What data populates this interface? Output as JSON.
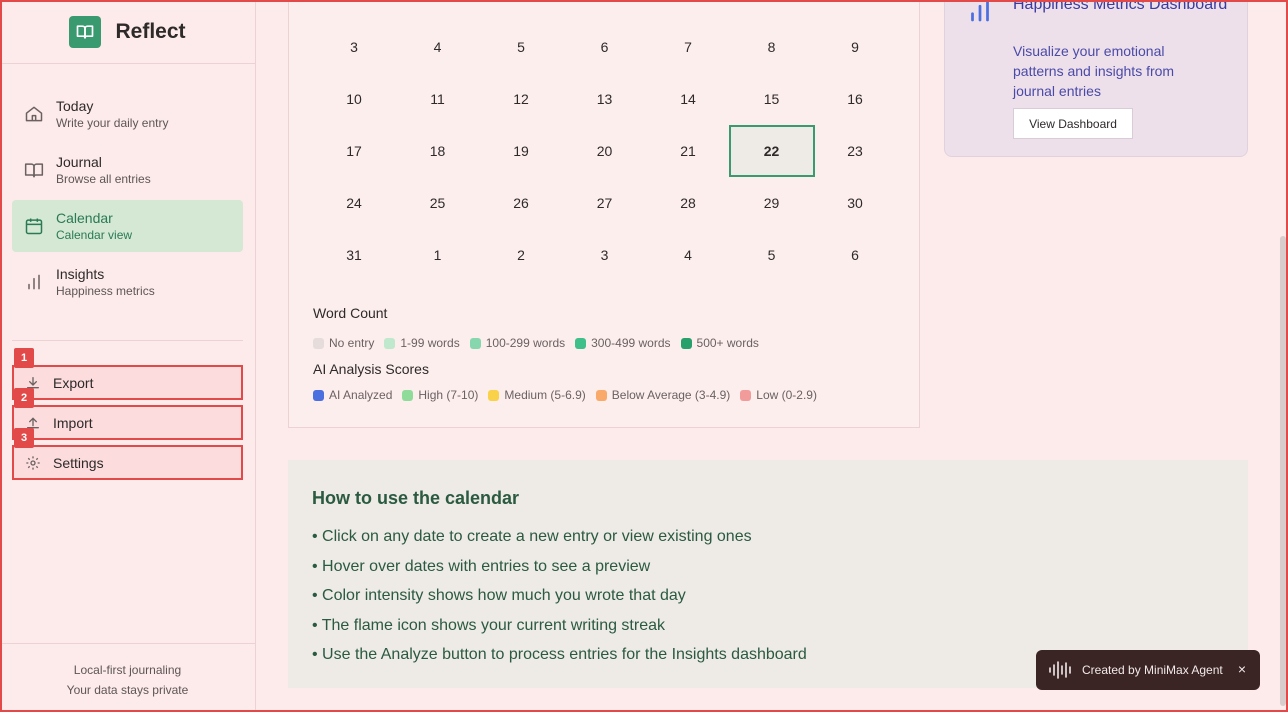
{
  "app": {
    "name": "Reflect"
  },
  "nav": [
    {
      "title": "Today",
      "sub": "Write your daily entry",
      "icon": "home-icon"
    },
    {
      "title": "Journal",
      "sub": "Browse all entries",
      "icon": "book-open-icon"
    },
    {
      "title": "Calendar",
      "sub": "Calendar view",
      "icon": "calendar-icon",
      "active": true
    },
    {
      "title": "Insights",
      "sub": "Happiness metrics",
      "icon": "bar-chart-icon"
    }
  ],
  "utils": [
    {
      "mark": "1",
      "label": "Export",
      "icon": "download-icon"
    },
    {
      "mark": "2",
      "label": "Import",
      "icon": "upload-icon"
    },
    {
      "mark": "3",
      "label": "Settings",
      "icon": "gear-icon"
    }
  ],
  "footer": {
    "line1": "Local-first journaling",
    "line2": "Your data stays private"
  },
  "calendar": {
    "weeks": [
      [
        "3",
        "4",
        "5",
        "6",
        "7",
        "8",
        "9"
      ],
      [
        "10",
        "11",
        "12",
        "13",
        "14",
        "15",
        "16"
      ],
      [
        "17",
        "18",
        "19",
        "20",
        "21",
        "22",
        "23"
      ],
      [
        "24",
        "25",
        "26",
        "27",
        "28",
        "29",
        "30"
      ],
      [
        "31",
        "1",
        "2",
        "3",
        "4",
        "5",
        "6"
      ]
    ],
    "selected": "22",
    "word_count_title": "Word Count",
    "word_count_legend": [
      {
        "label": "No entry",
        "color": "#e6dcdc"
      },
      {
        "label": "1-99 words",
        "color": "#bfe8cc"
      },
      {
        "label": "100-299 words",
        "color": "#86d6ae"
      },
      {
        "label": "300-499 words",
        "color": "#3fbf8a"
      },
      {
        "label": "500+ words",
        "color": "#27a06c"
      }
    ],
    "ai_title": "AI Analysis Scores",
    "ai_legend": [
      {
        "label": "AI Analyzed",
        "color": "#4c6fe0"
      },
      {
        "label": "High (7-10)",
        "color": "#8fdc9a"
      },
      {
        "label": "Medium (5-6.9)",
        "color": "#f9d24a"
      },
      {
        "label": "Below Average (3-4.9)",
        "color": "#f9a96a"
      },
      {
        "label": "Low (0-2.9)",
        "color": "#f29b9b"
      }
    ]
  },
  "dashboard": {
    "title": "Happiness Metrics Dashboard",
    "desc": "Visualize your emotional patterns and insights from journal entries",
    "button": "View Dashboard"
  },
  "howto": {
    "title": "How to use the calendar",
    "items": [
      "• Click on any date to create a new entry or view existing ones",
      "• Hover over dates with entries to see a preview",
      "• Color intensity shows how much you wrote that day",
      "• The flame icon shows your current writing streak",
      "• Use the Analyze button to process entries for the Insights dashboard"
    ]
  },
  "badge": {
    "label": "Created by MiniMax Agent",
    "close": "×"
  }
}
